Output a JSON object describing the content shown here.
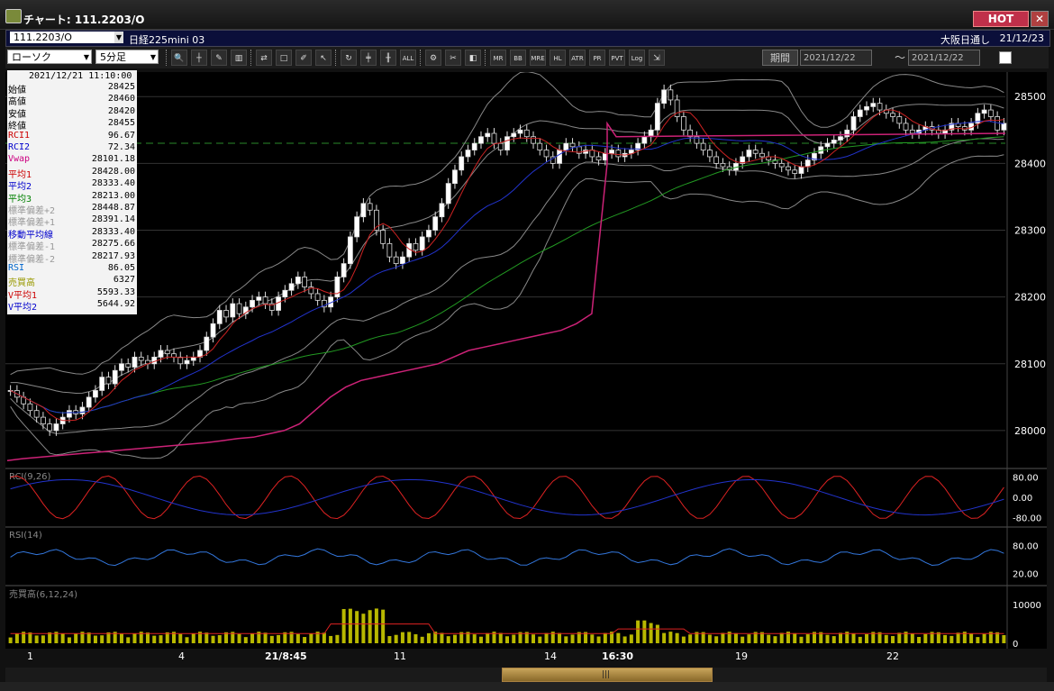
{
  "window": {
    "title": "チャート: 111.2203/O",
    "hot_label": "HOT",
    "close_label": "✕"
  },
  "header": {
    "symbol": "111.2203/O",
    "instrument": "日経225mini 03",
    "session": "大阪日通し",
    "date": "21/12/23"
  },
  "toolbar": {
    "chart_type": "ローソク",
    "timeframe": "5分足",
    "buttons": [
      "zoom-icon",
      "cursor-icon",
      "draw-icon",
      "chart-icon",
      "compare-icon",
      "note-icon",
      "pen-icon",
      "select-icon",
      "refresh-icon",
      "candle-icon",
      "bar-icon",
      "ALL",
      "settings-icon",
      "tool-icon",
      "color-icon",
      "MR",
      "BB",
      "MRE",
      "HL",
      "ATR",
      "PR",
      "PVT",
      "Log",
      "export-icon"
    ],
    "period_label": "期間",
    "date_from": "2021/12/22",
    "date_to": "2021/12/22",
    "range_sep": "〜"
  },
  "info_panel": {
    "timestamp": "2021/12/21 11:10:00",
    "rows": [
      {
        "label": "始値",
        "value": "28425",
        "color": "#000000"
      },
      {
        "label": "高値",
        "value": "28460",
        "color": "#000000"
      },
      {
        "label": "安値",
        "value": "28420",
        "color": "#000000"
      },
      {
        "label": "終値",
        "value": "28455",
        "color": "#000000"
      },
      {
        "label": "RCI1",
        "value": "96.67",
        "color": "#cc0000"
      },
      {
        "label": "RCI2",
        "value": "72.34",
        "color": "#0000cc"
      },
      {
        "label": "Vwap",
        "value": "28101.18",
        "color": "#cc0080"
      },
      {
        "label": "平均1",
        "value": "28428.00",
        "color": "#cc0000"
      },
      {
        "label": "平均2",
        "value": "28333.40",
        "color": "#0000cc"
      },
      {
        "label": "平均3",
        "value": "28213.00",
        "color": "#008000"
      },
      {
        "label": "標準偏差+2",
        "value": "28448.87",
        "color": "#999999"
      },
      {
        "label": "標準偏差+1",
        "value": "28391.14",
        "color": "#999999"
      },
      {
        "label": "移動平均線",
        "value": "28333.40",
        "color": "#0000cc"
      },
      {
        "label": "標準偏差-1",
        "value": "28275.66",
        "color": "#999999"
      },
      {
        "label": "標準偏差-2",
        "value": "28217.93",
        "color": "#999999"
      },
      {
        "label": "RSI",
        "value": "86.05",
        "color": "#0066cc"
      },
      {
        "label": "売買高",
        "value": "6327",
        "color": "#999900"
      },
      {
        "label": "V平均1",
        "value": "5593.33",
        "color": "#cc0000"
      },
      {
        "label": "V平均2",
        "value": "5644.92",
        "color": "#0000cc"
      }
    ]
  },
  "price_axis": [
    "28500",
    "28400",
    "28300",
    "28200",
    "28100",
    "28000"
  ],
  "panels": {
    "rci": {
      "label": "RCI(9,26)",
      "ticks": [
        "80.00",
        "0.00",
        "-80.00"
      ]
    },
    "rsi": {
      "label": "RSI(14)",
      "ticks": [
        "80.00",
        "20.00"
      ]
    },
    "volume": {
      "label": "売買高(6,12,24)",
      "ticks": [
        "10000",
        "0"
      ]
    }
  },
  "x_axis": [
    {
      "label": "1",
      "bold": false
    },
    {
      "label": "4",
      "bold": false
    },
    {
      "label": "21/8:45",
      "bold": true
    },
    {
      "label": "11",
      "bold": false
    },
    {
      "label": "14",
      "bold": false
    },
    {
      "label": "16:30",
      "bold": true
    },
    {
      "label": "19",
      "bold": false
    },
    {
      "label": "22",
      "bold": false
    }
  ],
  "colors": {
    "bg": "#000000",
    "up": "#ffffff",
    "down": "#000000",
    "ma1": "#cc2222",
    "ma2": "#2233cc",
    "ma3": "#229922",
    "vwap": "#cc2277",
    "band": "#888888",
    "rsi": "#3377dd",
    "vol": "#b8b800"
  },
  "chart_data": {
    "type": "line",
    "y_axis_ticks": [
      28000,
      28100,
      28200,
      28300,
      28400,
      28500
    ],
    "ylim": [
      27950,
      28530
    ],
    "x_ticks": [
      "1",
      "4",
      "21/8:45",
      "11",
      "14",
      "16:30",
      "19",
      "22"
    ],
    "close": [
      28060,
      28050,
      28040,
      28030,
      28020,
      28010,
      28000,
      28010,
      28020,
      28030,
      28025,
      28035,
      28050,
      28060,
      28080,
      28070,
      28090,
      28100,
      28095,
      28110,
      28105,
      28100,
      28110,
      28120,
      28115,
      28110,
      28100,
      28105,
      28110,
      28120,
      28140,
      28160,
      28180,
      28170,
      28190,
      28175,
      28185,
      28195,
      28200,
      28190,
      28180,
      28200,
      28210,
      28220,
      28230,
      28215,
      28205,
      28195,
      28185,
      28200,
      28230,
      28250,
      28290,
      28320,
      28340,
      28330,
      28300,
      28280,
      28260,
      28250,
      28260,
      28280,
      28270,
      28290,
      28300,
      28320,
      28340,
      28370,
      28390,
      28410,
      28420,
      28430,
      28440,
      28445,
      28430,
      28420,
      28440,
      28445,
      28450,
      28440,
      28430,
      28420,
      28410,
      28400,
      28420,
      28430,
      28425,
      28415,
      28420,
      28410,
      28405,
      28415,
      28420,
      28410,
      28415,
      28420,
      28430,
      28440,
      28450,
      28490,
      28510,
      28495,
      28470,
      28450,
      28440,
      28430,
      28420,
      28410,
      28400,
      28395,
      28390,
      28400,
      28410,
      28420,
      28415,
      28410,
      28405,
      28400,
      28395,
      28390,
      28385,
      28395,
      28405,
      28415,
      28425,
      28430,
      28435,
      28440,
      28450,
      28470,
      28480,
      28485,
      28490,
      28480,
      28475,
      28470,
      28460,
      28450,
      28445,
      28450,
      28455,
      28450,
      28445,
      28450,
      28460,
      28455,
      28450,
      28460,
      28475,
      28480,
      28470,
      28450,
      28460
    ],
    "vwap": [
      27955,
      27958,
      27960,
      27962,
      27964,
      27966,
      27968,
      27970,
      27972,
      27974,
      27976,
      27978,
      27980,
      27982,
      27985,
      27988,
      27990,
      27995,
      28000,
      28010,
      28030,
      28050,
      28065,
      28075,
      28080,
      28085,
      28090,
      28095,
      28100,
      28110,
      28120,
      28125,
      28130,
      28135,
      28140,
      28145,
      28150,
      28160,
      28175,
      28400
    ]
  }
}
